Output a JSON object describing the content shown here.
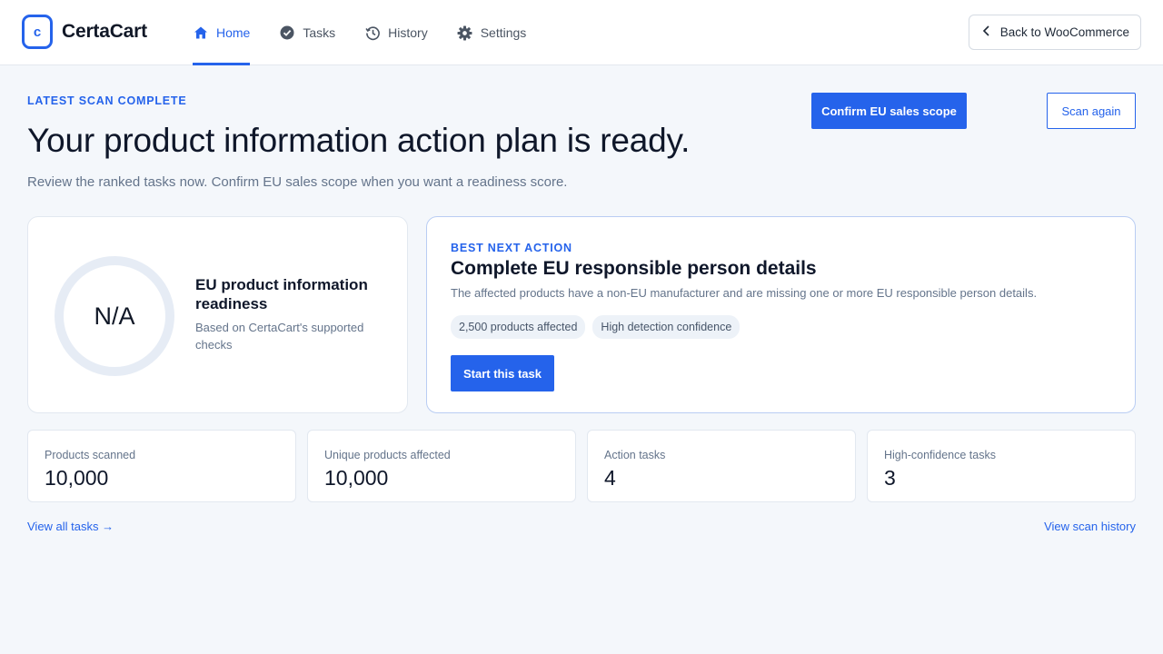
{
  "header": {
    "brand": "CertaCart",
    "logo_letter": "c",
    "nav": [
      {
        "label": "Home",
        "icon": "home-icon"
      },
      {
        "label": "Tasks",
        "icon": "check-circle-icon"
      },
      {
        "label": "History",
        "icon": "history-icon"
      },
      {
        "label": "Settings",
        "icon": "gear-icon"
      }
    ],
    "back_label": "Back to WooCommerce"
  },
  "hero": {
    "eyebrow": "LATEST SCAN COMPLETE",
    "title": "Your product information action plan is ready.",
    "subtitle": "Review the ranked tasks now. Confirm EU sales scope when you want a readiness score.",
    "confirm_button": "Confirm EU sales scope",
    "scan_button": "Scan again"
  },
  "readiness": {
    "value": "N/A",
    "title": "EU product information readiness",
    "subtitle": "Based on CertaCart's supported checks"
  },
  "next_action": {
    "eyebrow": "BEST NEXT ACTION",
    "title": "Complete EU responsible person details",
    "description": "The affected products have a non-EU manufacturer and are missing one or more EU responsible person details.",
    "chips": [
      "2,500 products affected",
      "High detection confidence"
    ],
    "button": "Start this task"
  },
  "stats": [
    {
      "label": "Products scanned",
      "value": "10,000"
    },
    {
      "label": "Unique products affected",
      "value": "10,000"
    },
    {
      "label": "Action tasks",
      "value": "4"
    },
    {
      "label": "High-confidence tasks",
      "value": "3"
    }
  ],
  "links": {
    "view_tasks": "View all tasks →",
    "view_history": "View scan history"
  },
  "colors": {
    "accent": "#2563eb",
    "background": "#f4f7fb"
  }
}
